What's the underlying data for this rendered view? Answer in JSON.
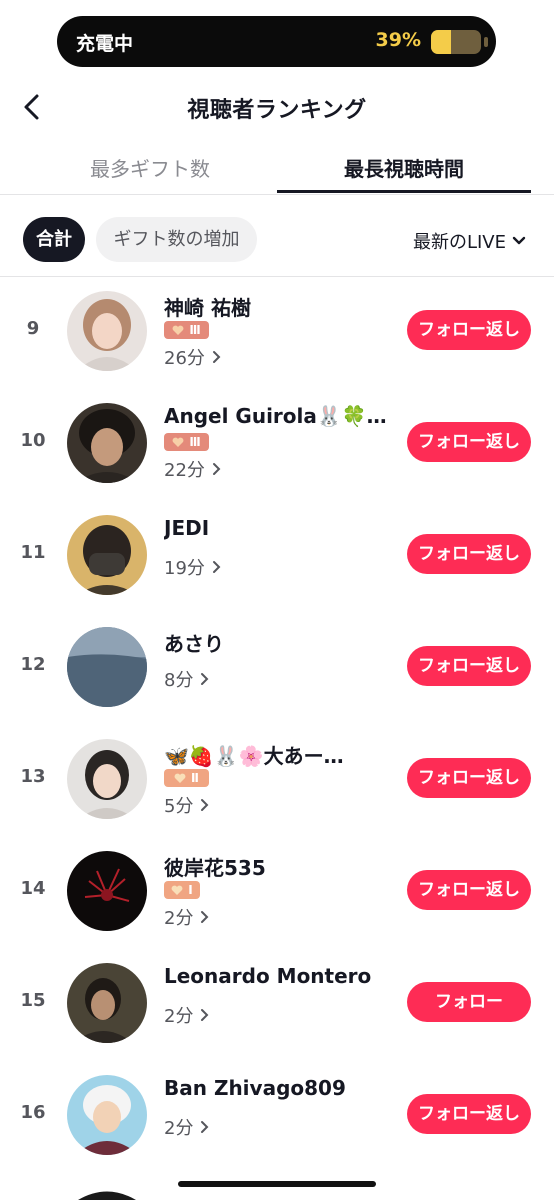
{
  "status": {
    "label": "充電中",
    "battery_percent": "39%",
    "battery_level": 0.39
  },
  "header": {
    "back_icon": "chevron-left-icon",
    "title": "視聴者ランキング"
  },
  "tabs": [
    {
      "label": "最多ギフト数",
      "active": false
    },
    {
      "label": "最長視聴時間",
      "active": true
    }
  ],
  "filters": {
    "chips": [
      {
        "label": "合計",
        "active": true
      },
      {
        "label": "ギフト数の増加",
        "active": false
      }
    ],
    "live_select": "最新のLIVE"
  },
  "colors": {
    "accent": "#fe2c55",
    "text": "#161823",
    "muted": "#55565c",
    "badge_high": "#e48a7a",
    "badge_low": "#f0a582"
  },
  "viewers": [
    {
      "rank": "9",
      "name": "神崎 祐樹",
      "badge": "Ⅲ",
      "duration": "26分",
      "button": "フォロー返し"
    },
    {
      "rank": "10",
      "name": "Angel Guirola🐰🍀…",
      "badge": "Ⅲ",
      "duration": "22分",
      "button": "フォロー返し"
    },
    {
      "rank": "11",
      "name": "JEDI",
      "badge": "",
      "duration": "19分",
      "button": "フォロー返し"
    },
    {
      "rank": "12",
      "name": "あさり",
      "badge": "",
      "duration": "8分",
      "button": "フォロー返し"
    },
    {
      "rank": "13",
      "name": "🦋🍓🐰🌸大あー…",
      "badge": "Ⅱ",
      "duration": "5分",
      "button": "フォロー返し"
    },
    {
      "rank": "14",
      "name": "彼岸花535",
      "badge": "Ⅰ",
      "duration": "2分",
      "button": "フォロー返し"
    },
    {
      "rank": "15",
      "name": "Leonardo Montero",
      "badge": "",
      "duration": "2分",
      "button": "フォロー"
    },
    {
      "rank": "16",
      "name": "Ban Zhivago809",
      "badge": "",
      "duration": "2分",
      "button": "フォロー返し"
    }
  ]
}
